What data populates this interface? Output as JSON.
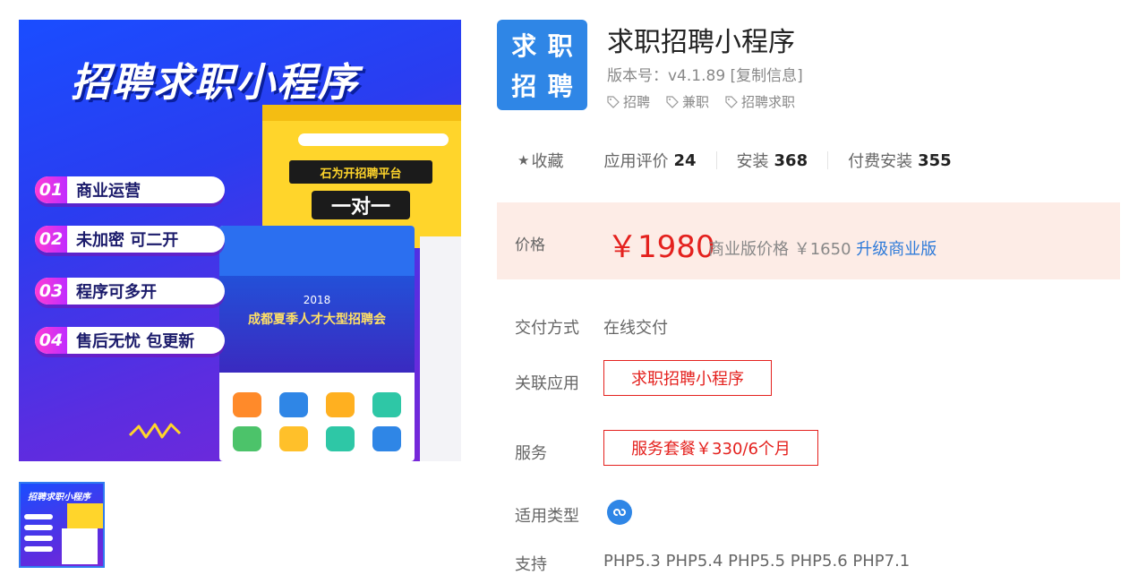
{
  "gallery": {
    "hero_title": "招聘求职小程序",
    "features": [
      {
        "num": "01",
        "text": "商业运营"
      },
      {
        "num": "02",
        "text": "未加密 可二开"
      },
      {
        "num": "03",
        "text": "程序可多开"
      },
      {
        "num": "04",
        "text": "售后无忧 包更新"
      }
    ],
    "yellow_banner": "石为开招聘平台",
    "yellow_banner2": "一对一",
    "blue_ad_line1": "2018",
    "blue_ad_line2": "成都夏季人才大型招聘会",
    "thumb_title": "招聘求职小程序"
  },
  "app": {
    "icon_chars": [
      "求",
      "职",
      "招",
      "聘"
    ],
    "name": "求职招聘小程序",
    "version_label": "版本号：",
    "version": "v4.1.89",
    "copy_label": "[复制信息]",
    "tags": [
      "招聘",
      "兼职",
      "招聘求职"
    ]
  },
  "stats": {
    "favorite_label": "收藏",
    "rating_label": "应用评价",
    "rating_value": "24",
    "install_label": "安装",
    "install_value": "368",
    "paid_label": "付费安装",
    "paid_value": "355"
  },
  "price": {
    "label": "价格",
    "main": "￥1980",
    "commercial_label": "商业版价格 ￥1650",
    "upgrade_label": "升级商业版"
  },
  "details": {
    "delivery_label": "交付方式",
    "delivery_value": "在线交付",
    "related_label": "关联应用",
    "related_value": "求职招聘小程序",
    "service_label": "服务",
    "service_value": "服务套餐￥330/6个月",
    "type_label": "适用类型",
    "support_label": "支持",
    "support_value": "PHP5.3 PHP5.4 PHP5.5 PHP5.6 PHP7.1"
  },
  "colors": {
    "accent_red": "#e4211e",
    "link_blue": "#2f7bd9",
    "icon_blue": "#2f86e6",
    "price_bg": "#fdece6"
  }
}
